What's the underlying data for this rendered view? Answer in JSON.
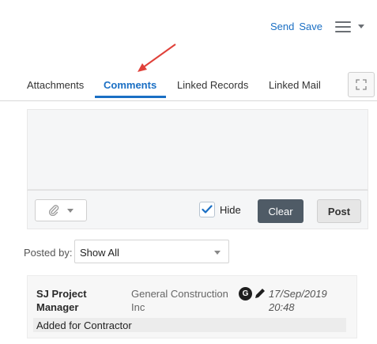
{
  "header": {
    "send_label": "Send",
    "save_label": "Save",
    "accent_color": "#1a6fc4"
  },
  "tabs": [
    {
      "label": "Attachments",
      "active": false
    },
    {
      "label": "Comments",
      "active": true
    },
    {
      "label": "Linked Records",
      "active": false
    },
    {
      "label": "Linked Mail",
      "active": false
    }
  ],
  "editor": {
    "hide_label": "Hide",
    "hide_checked": true,
    "clear_label": "Clear",
    "post_label": "Post",
    "clear_color": "#4f5b66"
  },
  "filter": {
    "label": "Posted by:",
    "value": "Show All"
  },
  "comments": [
    {
      "author": "SJ Project Manager",
      "company": "General Construction Inc",
      "visibility_badge": "G",
      "datetime": "17/Sep/2019 20:48",
      "text": "Added for Contractor"
    }
  ],
  "icons": {
    "menu": "hamburger-menu-icon",
    "attach": "paperclip-icon",
    "expand": "expand-icon",
    "edit": "pencil-icon"
  },
  "annotation_color": "#e0413a"
}
